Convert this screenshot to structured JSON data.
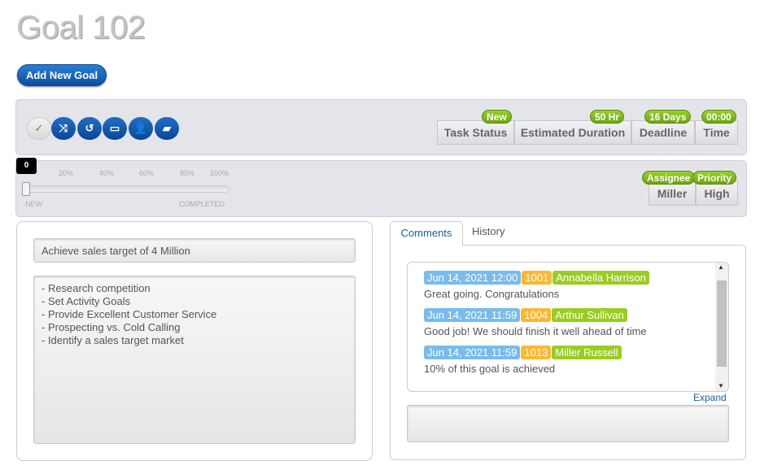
{
  "title": "Goal 102",
  "add_button": "Add New Goal",
  "toolbar_icons": [
    "check-icon",
    "shuffle-icon",
    "history-icon",
    "archive-icon",
    "add-user-icon",
    "comments-icon"
  ],
  "stats": [
    {
      "label": "Task Status",
      "badge": "New"
    },
    {
      "label": "Estimated Duration",
      "badge": "50 Hr"
    },
    {
      "label": "Deadline",
      "badge": "16 Days"
    },
    {
      "label": "Time",
      "badge": "00:00"
    }
  ],
  "progress": {
    "value": 0,
    "value_label": "0",
    "ticks": [
      "20%",
      "40%",
      "60%",
      "80%",
      "100%"
    ],
    "start_label": "NEW",
    "end_label": "COMPLETED"
  },
  "assignment": [
    {
      "label": "Miller",
      "badge": "Assignee"
    },
    {
      "label": "High",
      "badge": "Priority"
    }
  ],
  "goal_name": "Achieve sales target of 4 Million",
  "goal_description": "- Research competition\n- Set Activity Goals\n- Provide Excellent Customer Service\n- Prospecting vs. Cold Calling\n- Identify a sales target market",
  "tabs": [
    "Comments",
    "History"
  ],
  "comments": [
    {
      "date": "Jun 14, 2021 12:00",
      "id": "1001",
      "user": "Annabella Harrison",
      "text": "Great going. Congratulations"
    },
    {
      "date": "Jun 14, 2021 11:59",
      "id": "1004",
      "user": "Arthur Sullivan",
      "text": "Good job! We should finish it well ahead of time"
    },
    {
      "date": "Jun 14, 2021 11:59",
      "id": "1013",
      "user": "Miller Russell",
      "text": "10% of this goal is achieved"
    }
  ],
  "expand_label": "Expand",
  "colors": {
    "date": "#79bbee",
    "id": "#fbb830",
    "user": "#9acc22",
    "accent": "#0b4fa0"
  }
}
